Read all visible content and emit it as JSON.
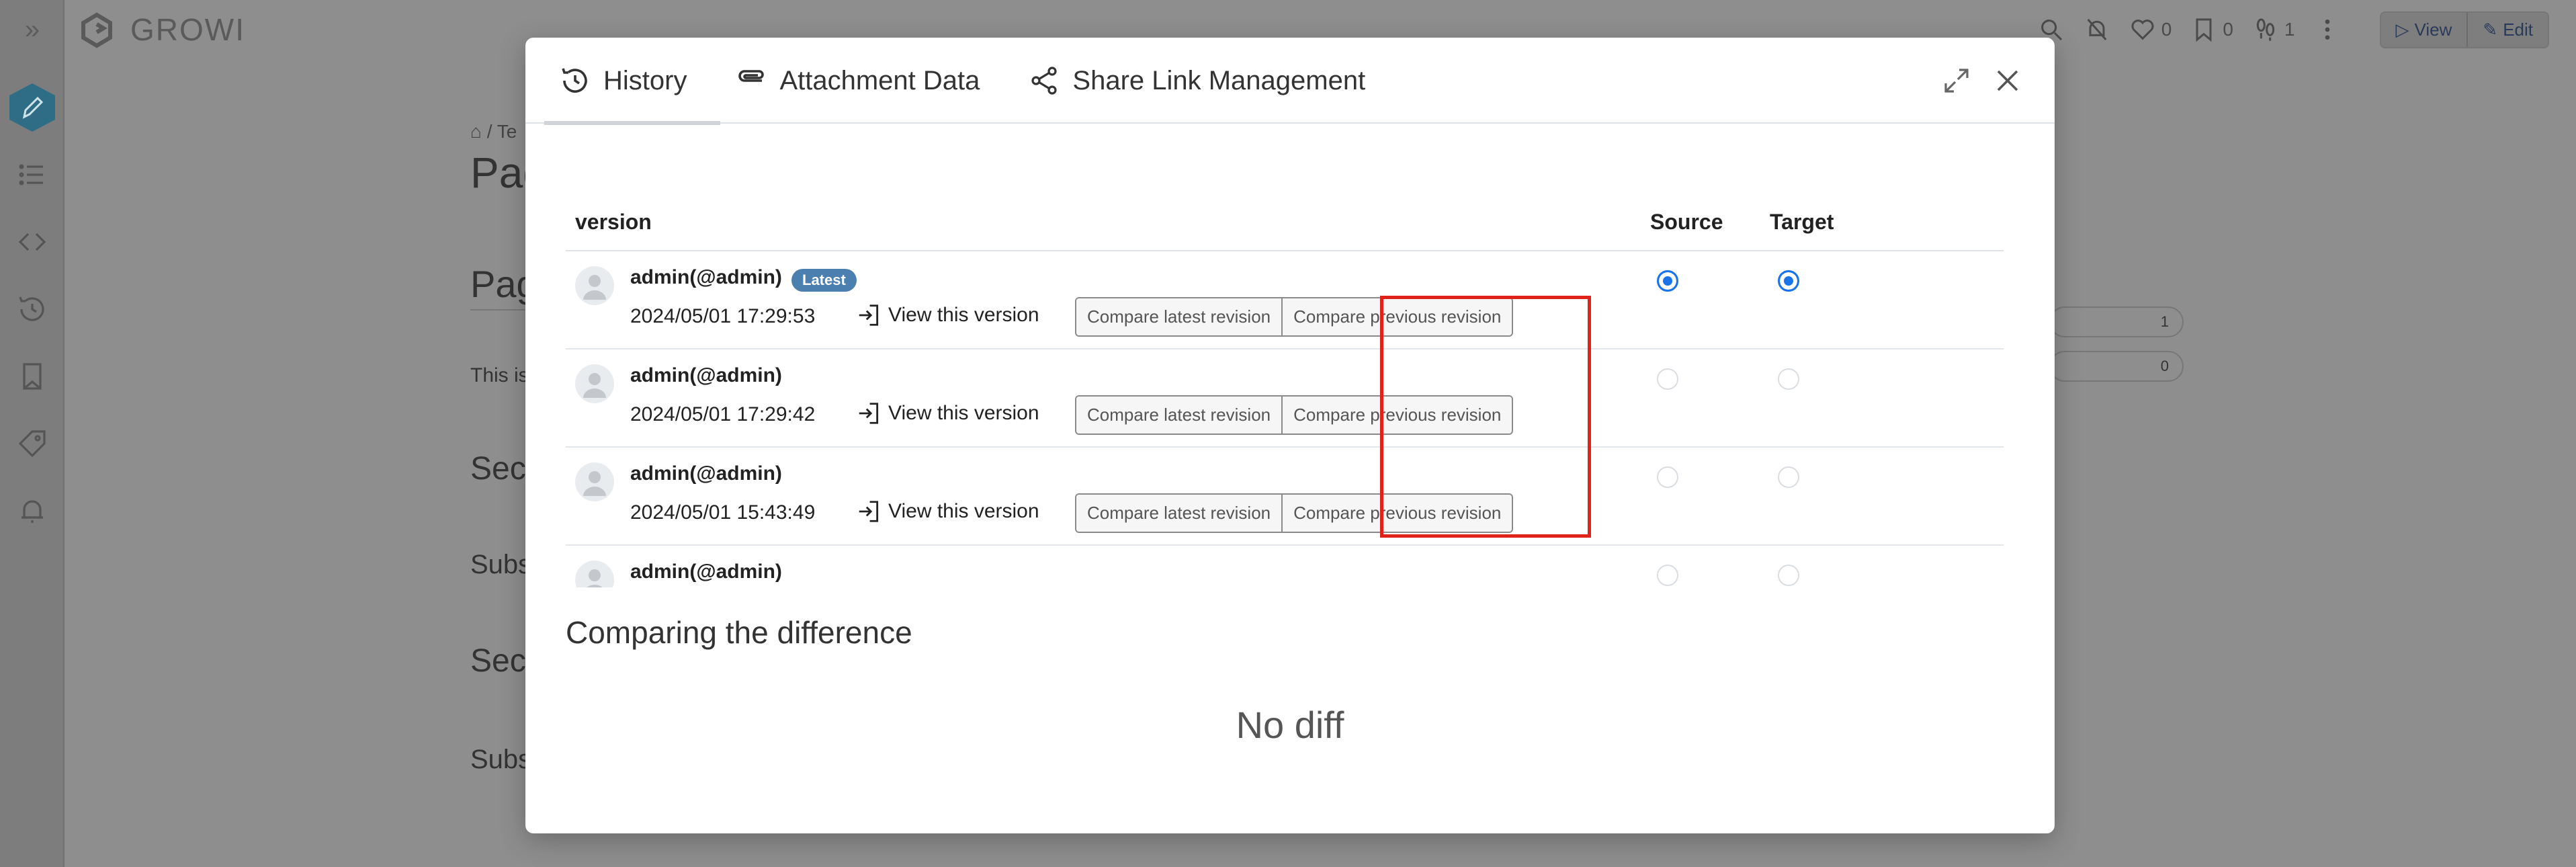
{
  "app": {
    "brand": "GROWI",
    "top_actions": {
      "like_count": "0",
      "bookmark_count": "0",
      "seen_count": "1",
      "view_label": "View",
      "edit_label": "Edit"
    }
  },
  "background_page": {
    "breadcrumb": "/ Te",
    "title": "Pag",
    "heading": "Pag",
    "paragraph": "This is",
    "sections": [
      "Sect",
      "Subs",
      "Sect",
      "Subs"
    ],
    "pill_counts": [
      "1",
      "0"
    ]
  },
  "modal": {
    "tabs": [
      {
        "label": "History",
        "icon": "history-icon",
        "active": true
      },
      {
        "label": "Attachment Data",
        "icon": "paperclip-icon",
        "active": false
      },
      {
        "label": "Share Link Management",
        "icon": "share-icon",
        "active": false
      }
    ],
    "table": {
      "headers": {
        "version": "version",
        "source": "Source",
        "target": "Target"
      },
      "rows": [
        {
          "author": "admin(@admin)",
          "badge": "Latest",
          "date": "2024/05/01 17:29:53",
          "view_label": "View this version",
          "compare_latest": "Compare latest revision",
          "compare_previous": "Compare previous revision",
          "source_selected": true,
          "target_selected": true
        },
        {
          "author": "admin(@admin)",
          "badge": "",
          "date": "2024/05/01 17:29:42",
          "view_label": "View this version",
          "compare_latest": "Compare latest revision",
          "compare_previous": "Compare previous revision",
          "source_selected": false,
          "target_selected": false
        },
        {
          "author": "admin(@admin)",
          "badge": "",
          "date": "2024/05/01 15:43:49",
          "view_label": "View this version",
          "compare_latest": "Compare latest revision",
          "compare_previous": "Compare previous revision",
          "source_selected": false,
          "target_selected": false
        },
        {
          "author": "admin(@admin)",
          "badge": "",
          "date": "",
          "view_label": "",
          "compare_latest": "",
          "compare_previous": "",
          "source_selected": false,
          "target_selected": false
        }
      ]
    },
    "diff_title": "Comparing the difference",
    "no_diff": "No diff"
  },
  "colors": {
    "highlight": "#e0231a",
    "radio_selected": "#1a73e8",
    "badge": "#4a7fb0",
    "overlay": "#8e8e8e"
  }
}
